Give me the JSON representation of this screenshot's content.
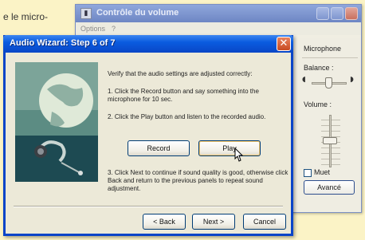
{
  "page": {
    "text_fragment": "e le micro-"
  },
  "volume_window": {
    "title": "Contrôle du volume",
    "menu": [
      "Options",
      "?"
    ],
    "mic_panel": {
      "title": "Microphone",
      "balance_label": "Balance :",
      "volume_label": "Volume :",
      "mute_label": "Muet",
      "advanced_label": "Avancé"
    }
  },
  "wizard": {
    "title": "Audio Wizard: Step 6 of 7",
    "intro": "Verify that the audio settings are adjusted correctly:",
    "step1": "1. Click the Record button and say something into the microphone for 10 sec.",
    "step2": "2. Click the Play button and listen to the recorded audio.",
    "step3": "3. Click Next to continue if sound quality is good, otherwise click Back and return to the previous panels to repeat sound adjustment.",
    "record_label": "Record",
    "play_label": "Play",
    "back_label": "< Back",
    "next_label": "Next >",
    "cancel_label": "Cancel"
  },
  "colors": {
    "titlebar": "#0a5ce0",
    "volume_titlebar": "#7b93cd",
    "background": "#fbf3c6"
  }
}
